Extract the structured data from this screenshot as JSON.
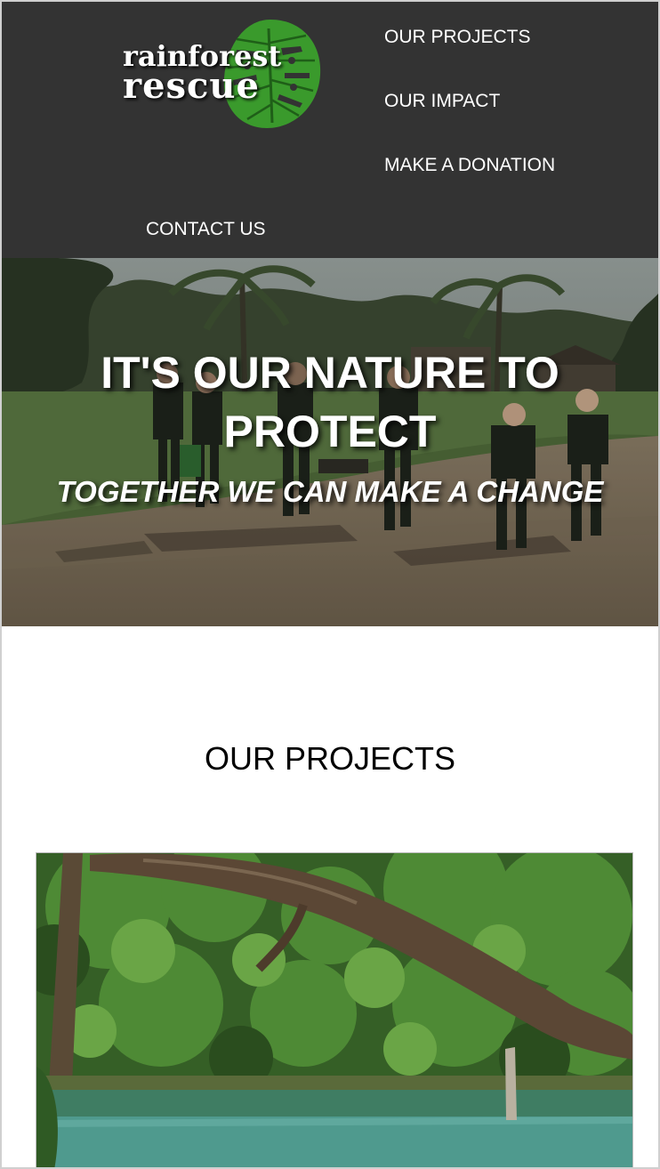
{
  "header": {
    "logo": {
      "line1": "rainforest",
      "line2": "rescue",
      "icon": "monstera-leaf-icon",
      "leaf_color": "#3a9a2c"
    },
    "nav": {
      "projects": "OUR PROJECTS",
      "impact": "OUR IMPACT",
      "donate": "MAKE A DONATION",
      "contact": "CONTACT US"
    },
    "background_color": "#333333"
  },
  "hero": {
    "title": "IT'S OUR NATURE TO PROTECT",
    "subtitle": "TOGETHER WE CAN MAKE A CHANGE"
  },
  "projects": {
    "heading": "OUR PROJECTS"
  }
}
